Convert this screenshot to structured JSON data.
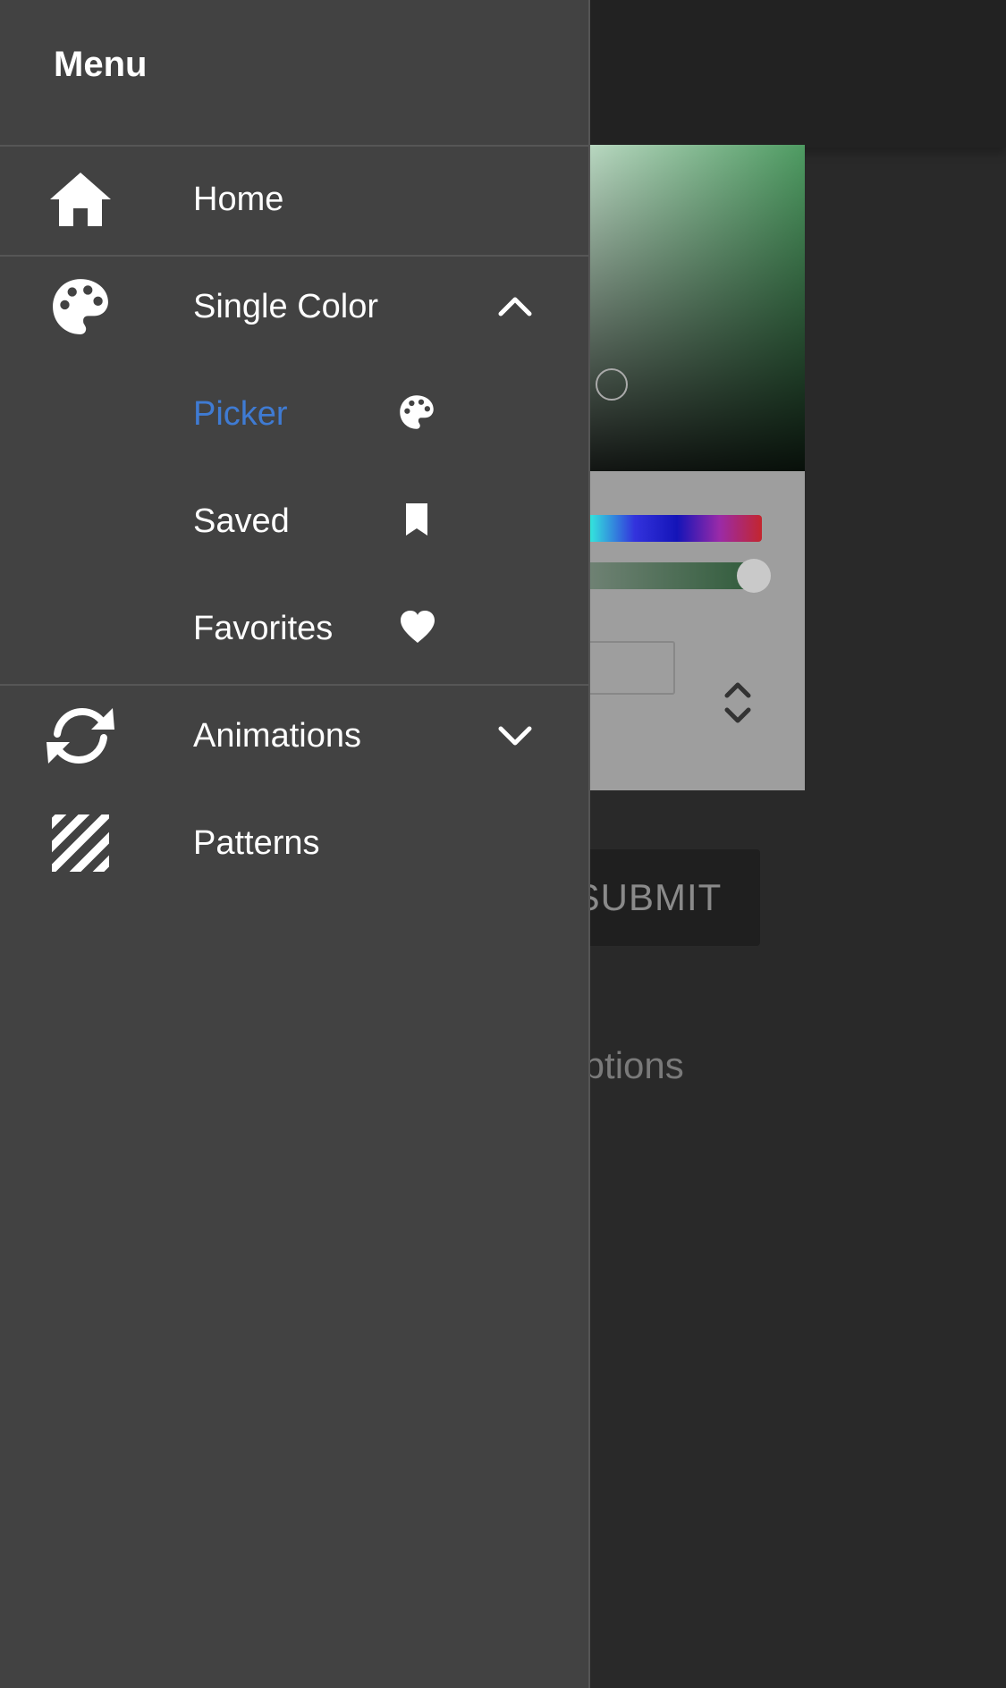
{
  "drawer": {
    "title": "Menu",
    "items": [
      {
        "label": "Home",
        "icon": "home-icon"
      },
      {
        "label": "Single Color",
        "icon": "palette-icon",
        "expanded": true
      },
      {
        "label": "Animations",
        "icon": "sync-icon",
        "expanded": false
      },
      {
        "label": "Patterns",
        "icon": "stripes-icon"
      }
    ],
    "single_color_subitems": [
      {
        "label": "Picker",
        "icon": "palette-icon",
        "active": true
      },
      {
        "label": "Saved",
        "icon": "bookmark-icon"
      },
      {
        "label": "Favorites",
        "icon": "heart-icon"
      }
    ],
    "active_color": "#3f7bd3"
  },
  "background": {
    "submit_label": "SUBMIT",
    "options_label": "Options",
    "picker_color": "#4e9b62"
  }
}
